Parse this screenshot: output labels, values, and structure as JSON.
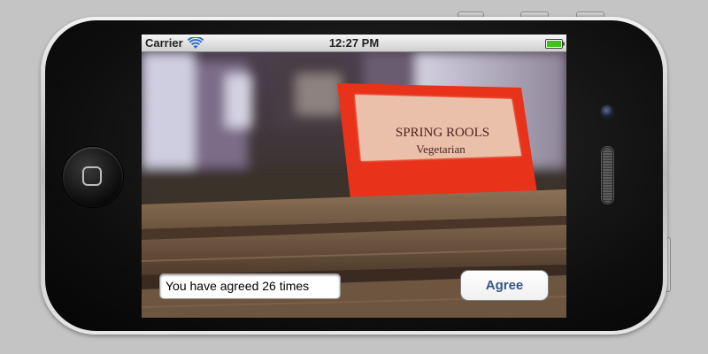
{
  "status_bar": {
    "carrier": "Carrier",
    "time": "12:27 PM",
    "wifi_icon": "wifi-icon",
    "battery_icon": "battery-icon",
    "battery_color": "#3dc21b"
  },
  "camera_view": {
    "sign_title": "SPRING ROOLS",
    "sign_subtitle": "Vegetarian",
    "sign_color": "#e8321a"
  },
  "controls": {
    "agree_counter_text": "You have agreed 26 times",
    "agree_button_label": "Agree",
    "agree_button_color": "#385487"
  },
  "device": {
    "home_button_icon": "home-button-icon",
    "camera_icon": "front-camera-icon",
    "speaker_icon": "earpiece-speaker-icon"
  }
}
